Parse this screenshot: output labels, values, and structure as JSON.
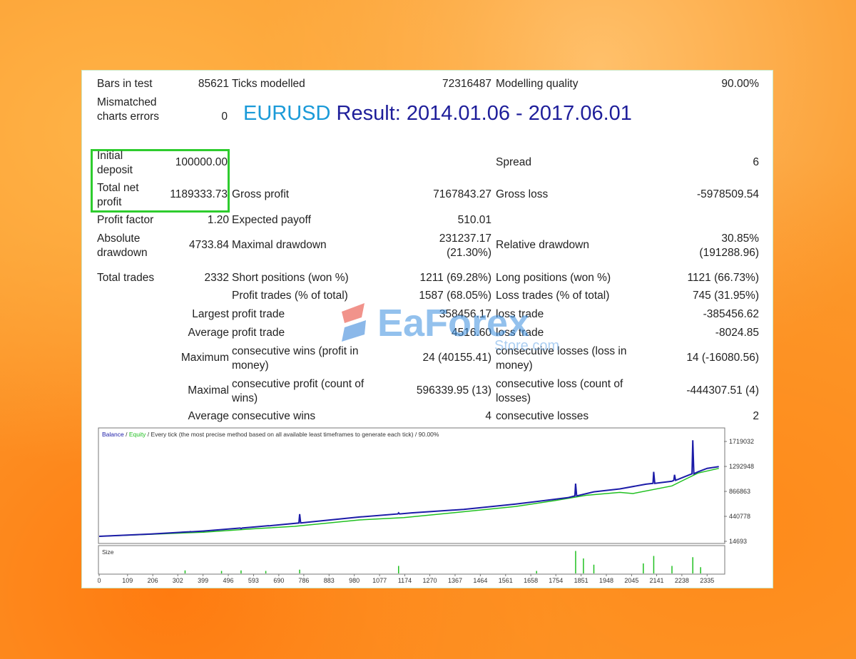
{
  "report": {
    "bars_in_test_label": "Bars in test",
    "bars_in_test": "85621",
    "ticks_modelled_label": "Ticks modelled",
    "ticks_modelled": "72316487",
    "modelling_quality_label": "Modelling quality",
    "modelling_quality": "90.00%",
    "mismatched_label": "Mismatched charts errors",
    "mismatched": "0",
    "title_symbol": "EURUSD",
    "title_rest": " Result: 2014.01.06 - 2017.06.01",
    "initial_deposit_label": "Initial deposit",
    "initial_deposit": "100000.00",
    "spread_label": "Spread",
    "spread": "6",
    "total_net_profit_label": "Total net profit",
    "total_net_profit": "1189333.73",
    "gross_profit_label": "Gross profit",
    "gross_profit": "7167843.27",
    "gross_loss_label": "Gross loss",
    "gross_loss": "-5978509.54",
    "profit_factor_label": "Profit factor",
    "profit_factor": "1.20",
    "expected_payoff_label": "Expected payoff",
    "expected_payoff": "510.01",
    "absolute_drawdown_label": "Absolute drawdown",
    "absolute_drawdown": "4733.84",
    "maximal_drawdown_label": "Maximal drawdown",
    "maximal_drawdown_1": "231237.17",
    "maximal_drawdown_2": "(21.30%)",
    "relative_drawdown_label": "Relative drawdown",
    "relative_drawdown_1": "30.85%",
    "relative_drawdown_2": "(191288.96)",
    "total_trades_label": "Total trades",
    "total_trades": "2332",
    "short_positions_label": "Short positions (won %)",
    "short_positions": "1211 (69.28%)",
    "long_positions_label": "Long positions (won %)",
    "long_positions": "1121 (66.73%)",
    "profit_trades_label": "Profit trades (% of total)",
    "profit_trades": "1587 (68.05%)",
    "loss_trades_label": "Loss trades (% of total)",
    "loss_trades": "745 (31.95%)",
    "largest_label": "Largest",
    "largest_profit_label": "profit trade",
    "largest_profit": "358456.17",
    "largest_loss_label": "loss trade",
    "largest_loss": "-385456.62",
    "average_label": "Average",
    "average_profit_label": "profit trade",
    "average_profit": "4516.60",
    "average_loss_label": "loss trade",
    "average_loss": "-8024.85",
    "maximum_label": "Maximum",
    "max_cons_wins_label": "consecutive wins (profit in money)",
    "max_cons_wins": "24 (40155.41)",
    "max_cons_losses_label": "consecutive losses (loss in money)",
    "max_cons_losses": "14 (-16080.56)",
    "maximal_label": "Maximal",
    "maximal_cons_profit_label": "consecutive profit (count of wins)",
    "maximal_cons_profit": "596339.95 (13)",
    "maximal_cons_loss_label": "consecutive loss (count of losses)",
    "maximal_cons_loss": "-444307.51 (4)",
    "average2_label": "Average",
    "avg_cons_wins_label": "consecutive wins",
    "avg_cons_wins": "4",
    "avg_cons_losses_label": "consecutive losses",
    "avg_cons_losses": "2"
  },
  "watermark": {
    "brand": "EaForex",
    "sub": "Store.com"
  },
  "chart_data": {
    "type": "line",
    "legend_balance": "Balance",
    "legend_equity": "Equity",
    "legend_rest": " / Every tick (the most precise method based on all available least timeframes to generate each tick) / 90.00%",
    "subchart_label": "Size",
    "y_ticks": [
      1719032,
      1292948,
      866863,
      440778,
      14693
    ],
    "ylim": [
      14693,
      1719032
    ],
    "x_ticks": [
      0,
      109,
      206,
      302,
      399,
      496,
      593,
      690,
      786,
      883,
      980,
      1077,
      1174,
      1270,
      1367,
      1464,
      1561,
      1658,
      1754,
      1851,
      1948,
      2045,
      2141,
      2238,
      2335
    ],
    "xlim": [
      0,
      2400
    ],
    "series": [
      {
        "name": "Balance",
        "color": "#1c1ca8",
        "x": [
          0,
          200,
          400,
          600,
          800,
          1000,
          1200,
          1400,
          1600,
          1800,
          1900,
          2000,
          2100,
          2200,
          2250,
          2300,
          2335,
          2380
        ],
        "values": [
          100000,
          140000,
          190000,
          260000,
          340000,
          430000,
          500000,
          560000,
          650000,
          760000,
          860000,
          910000,
          990000,
          1040000,
          1120000,
          1200000,
          1260000,
          1289000
        ]
      },
      {
        "name": "Equity",
        "color": "#20c020",
        "x": [
          0,
          200,
          400,
          600,
          750,
          1000,
          1170,
          1400,
          1600,
          1750,
          1870,
          2000,
          2050,
          2200,
          2240,
          2300,
          2380
        ],
        "values": [
          100000,
          135000,
          170000,
          230000,
          270000,
          380000,
          420000,
          520000,
          610000,
          710000,
          800000,
          850000,
          830000,
          960000,
          1050000,
          1180000,
          1260000
        ]
      }
    ],
    "spikes": [
      {
        "x": 350,
        "value": 180000
      },
      {
        "x": 545,
        "value": 230000
      },
      {
        "x": 653,
        "value": 280000
      },
      {
        "x": 770,
        "value": 480000
      },
      {
        "x": 1150,
        "value": 500000
      },
      {
        "x": 1830,
        "value": 1000000
      },
      {
        "x": 2130,
        "value": 1200000
      },
      {
        "x": 2210,
        "value": 1150000
      },
      {
        "x": 2280,
        "value": 1740000
      }
    ],
    "size_bars": [
      {
        "x": 330,
        "value": 0.12
      },
      {
        "x": 470,
        "value": 0.1
      },
      {
        "x": 545,
        "value": 0.12
      },
      {
        "x": 640,
        "value": 0.1
      },
      {
        "x": 770,
        "value": 0.15
      },
      {
        "x": 1150,
        "value": 0.3
      },
      {
        "x": 1680,
        "value": 0.1
      },
      {
        "x": 1830,
        "value": 0.9
      },
      {
        "x": 1860,
        "value": 0.6
      },
      {
        "x": 1900,
        "value": 0.35
      },
      {
        "x": 2090,
        "value": 0.4
      },
      {
        "x": 2130,
        "value": 0.7
      },
      {
        "x": 2200,
        "value": 0.3
      },
      {
        "x": 2280,
        "value": 0.65
      },
      {
        "x": 2310,
        "value": 0.25
      }
    ]
  }
}
